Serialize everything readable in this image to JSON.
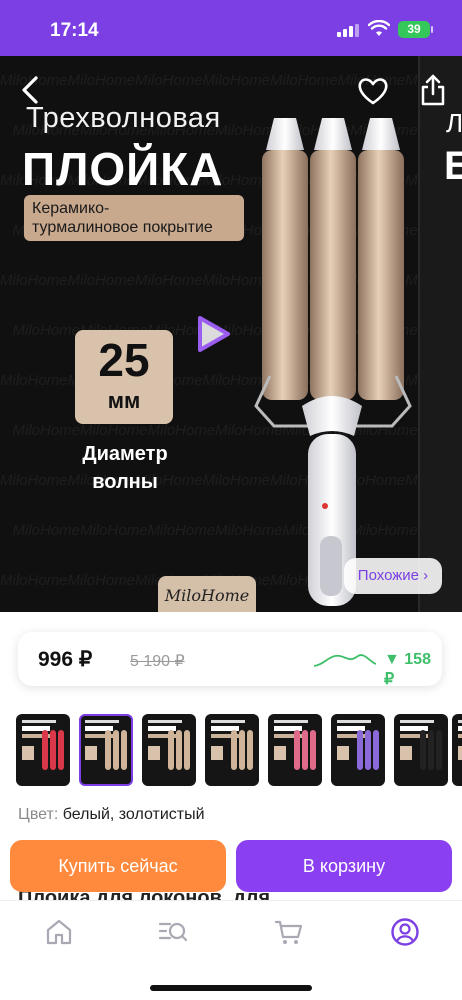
{
  "status_bar": {
    "time": "17:14",
    "battery": "39"
  },
  "hero": {
    "title_line1": "Трехволновая",
    "title_line2": "ПЛОЙКА",
    "coating": "Керамико-\nтурмалиновое покрытие",
    "size_value": "25",
    "size_unit": "мм",
    "caption": "Диаметр волны",
    "brand": "MiloHome",
    "watermark": "MiloHome",
    "similar_label": "Похожие ›",
    "next_peek_1": "Л",
    "next_peek_2": "Б"
  },
  "price": {
    "current": "996 ₽",
    "old": "5 190 ₽",
    "drop": "▼ 158 ₽"
  },
  "thumbnails": [
    {
      "rods": "#d8384a",
      "selected": false
    },
    {
      "rods": "#cfb49a",
      "selected": true
    },
    {
      "rods": "#cfb49a",
      "selected": false
    },
    {
      "rods": "#cfb49a",
      "selected": false
    },
    {
      "rods": "#e06a8a",
      "selected": false
    },
    {
      "rods": "#8a6ad8",
      "selected": false
    },
    {
      "rods": "#222222",
      "selected": false
    },
    {
      "rods": "#222222",
      "selected": false
    }
  ],
  "color": {
    "label": "Цвет:",
    "value": "белый, золотистый"
  },
  "actions": {
    "buy_now": "Купить сейчас",
    "to_cart": "В корзину"
  },
  "title_peek": "Плойка для локонов, для",
  "colors": {
    "accent": "#7b3fe4",
    "buy": "#ff8a3d",
    "cart": "#8a3ff0",
    "price_drop": "#3fbf6a"
  },
  "icons": {
    "back": "chevron-left-icon",
    "favorite": "heart-icon",
    "share": "share-icon",
    "play": "play-icon",
    "home": "home-icon",
    "catalog": "catalog-search-icon",
    "cart": "cart-icon",
    "profile": "profile-icon"
  }
}
